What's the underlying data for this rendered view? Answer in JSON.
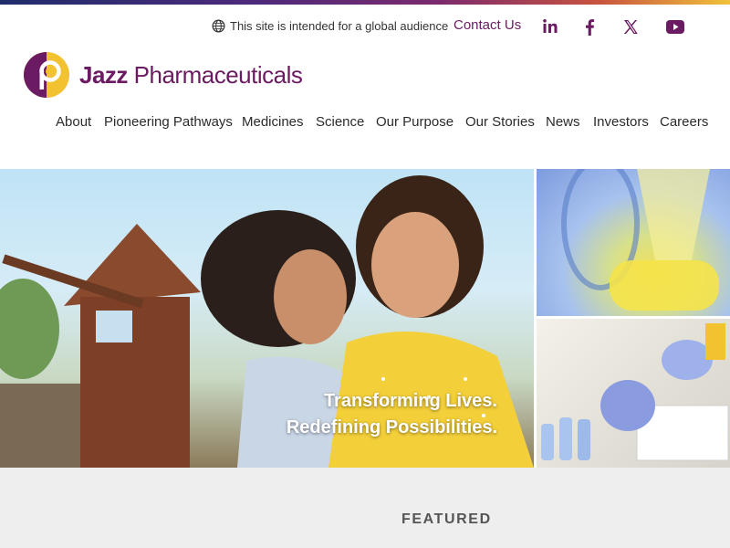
{
  "utility": {
    "global_notice": "This site is intended for a global audience",
    "contact": "Contact Us",
    "social": [
      {
        "icon": "linkedin-icon",
        "label": "in"
      },
      {
        "icon": "facebook-icon",
        "label": "f"
      },
      {
        "icon": "x-icon",
        "label": "X"
      },
      {
        "icon": "youtube-icon",
        "label": ""
      }
    ]
  },
  "brand": {
    "name_bold": "Jazz",
    "name_light": "Pharmaceuticals",
    "color": "#6b1b61",
    "accent": "#f2c230"
  },
  "nav": [
    "About",
    "Pioneering Pathways",
    "Medicines",
    "Science",
    "Our Purpose",
    "Our Stories",
    "News",
    "Investors",
    "Careers"
  ],
  "hero": {
    "line1": "Transforming Lives.",
    "line2": "Redefining Possibilities."
  },
  "featured": {
    "heading": "FEATURED"
  }
}
